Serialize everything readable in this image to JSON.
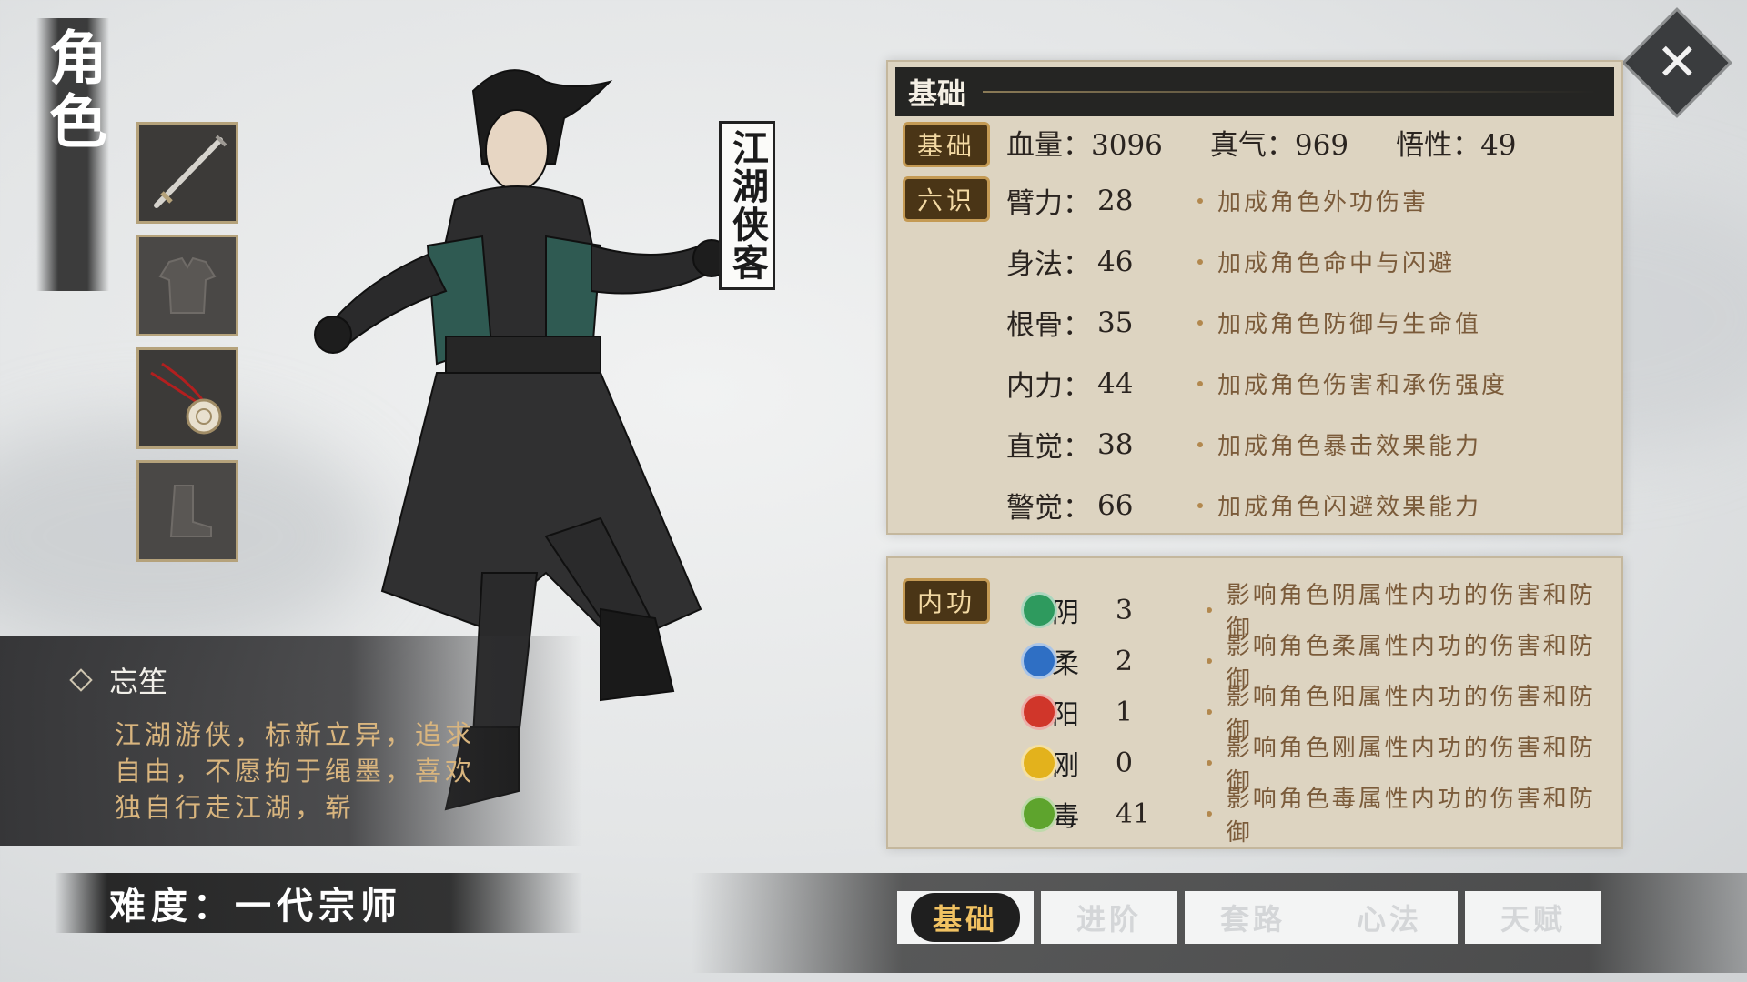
{
  "page": {
    "title": "角色",
    "close_label": "✕"
  },
  "equipment": {
    "slots": [
      {
        "name": "weapon",
        "icon": "sword-icon",
        "filled": true
      },
      {
        "name": "armor",
        "icon": "robe-icon",
        "filled": false
      },
      {
        "name": "accessory",
        "icon": "amulet-icon",
        "filled": true
      },
      {
        "name": "boots",
        "icon": "boots-icon",
        "filled": false
      }
    ]
  },
  "character": {
    "nickname": "江湖侠客",
    "name": "忘笙",
    "bio": "江湖游侠，标新立异，追求自由，不愿拘于绳墨，喜欢独自行走江湖，崭",
    "difficulty": "难度：一代宗师"
  },
  "basic_panel": {
    "header": "基础",
    "badge_basic": "基础",
    "badge_six": "六识",
    "hp": "血量：3096",
    "qi": "真气：969",
    "wisdom": "悟性：49",
    "attributes": [
      {
        "name": "臂力：",
        "value": "28",
        "desc": "加成角色外功伤害"
      },
      {
        "name": "身法：",
        "value": "46",
        "desc": "加成角色命中与闪避"
      },
      {
        "name": "根骨：",
        "value": "35",
        "desc": "加成角色防御与生命值"
      },
      {
        "name": "内力：",
        "value": "44",
        "desc": "加成角色伤害和承伤强度"
      },
      {
        "name": "直觉：",
        "value": "38",
        "desc": "加成角色暴击效果能力"
      },
      {
        "name": "警觉：",
        "value": "66",
        "desc": "加成角色闪避效果能力"
      }
    ]
  },
  "inner_panel": {
    "badge": "内功",
    "elements": [
      {
        "char": "阴",
        "value": "3",
        "desc": "影响角色阴属性内功的伤害和防御",
        "color": "#2e9a5e"
      },
      {
        "char": "柔",
        "value": "2",
        "desc": "影响角色柔属性内功的伤害和防御",
        "color": "#2f6fc4"
      },
      {
        "char": "阳",
        "value": "1",
        "desc": "影响角色阳属性内功的伤害和防御",
        "color": "#d0362a"
      },
      {
        "char": "刚",
        "value": "0",
        "desc": "影响角色刚属性内功的伤害和防御",
        "color": "#e3b21c"
      },
      {
        "char": "毒",
        "value": "41",
        "desc": "影响角色毒属性内功的伤害和防御",
        "color": "#5ea42d"
      }
    ]
  },
  "tabs": {
    "basic": "基础",
    "advanced": "进阶",
    "moves": "套路",
    "mind": "心法",
    "talent": "天赋"
  }
}
